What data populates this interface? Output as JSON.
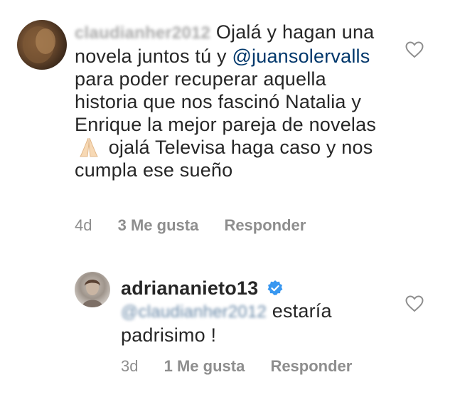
{
  "comments": [
    {
      "blurred_username": "claudianher2012",
      "text_parts": {
        "p1": "Ojalá y hagan una novela juntos tú y",
        "mention": "@juansolervalls",
        "p2": "para poder recuperar aquella historia que nos fascinó Natalia y Enrique la mejor pareja de novelas",
        "emoji": "folded-hands-emoji",
        "p3": "ojalá Televisa haga caso y nos cumpla ese sueño"
      },
      "time": "4d",
      "likes": "3 Me gusta",
      "reply_label": "Responder"
    },
    {
      "username": "adriananieto13",
      "verified": true,
      "blurred_mention": "@claudianher2012",
      "text": "estaría padrisimo !",
      "time": "3d",
      "likes": "1 Me gusta",
      "reply_label": "Responder"
    }
  ],
  "icons": {
    "like": "heart-outline-icon",
    "verified": "verified-badge-icon"
  },
  "colors": {
    "text": "#262626",
    "secondary": "#8e8e8e",
    "mention": "#00376b",
    "verified": "#3897f0"
  }
}
